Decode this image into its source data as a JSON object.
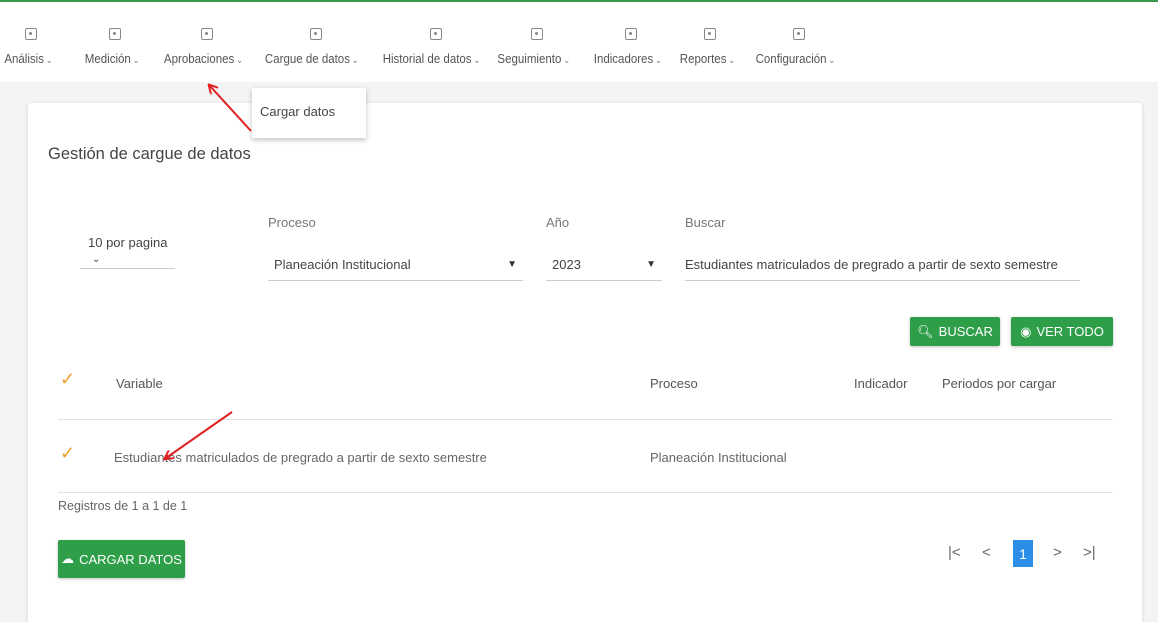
{
  "nav": {
    "items": [
      {
        "label": "Análisis"
      },
      {
        "label": "Medición"
      },
      {
        "label": "Aprobaciones"
      },
      {
        "label": "Cargue de datos"
      },
      {
        "label": "Historial de datos"
      },
      {
        "label": "Seguimiento"
      },
      {
        "label": "Indicadores"
      },
      {
        "label": "Reportes"
      },
      {
        "label": "Configuración"
      }
    ],
    "chevron": "⌄"
  },
  "dropdown": {
    "item": "Cargar datos"
  },
  "page": {
    "title": "Gestión de cargue de datos"
  },
  "filters": {
    "per_page": "10 por pagina",
    "proceso_label": "Proceso",
    "proceso_value": "Planeación Institucional",
    "anio_label": "Año",
    "anio_value": "2023",
    "buscar_label": "Buscar",
    "buscar_value": "Estudiantes matriculados de pregrado a partir de sexto semestre"
  },
  "buttons": {
    "buscar": "BUSCAR",
    "ver_todo": "VER TODO",
    "cargar_datos": "CARGAR DATOS"
  },
  "table": {
    "headers": [
      "Variable",
      "Proceso",
      "Indicador",
      "Periodos por cargar"
    ],
    "rows": [
      {
        "variable": "Estudiantes matriculados de pregrado a partir de sexto semestre",
        "proceso": "Planeación Institucional",
        "indicador": "",
        "periodos": ""
      }
    ]
  },
  "footer": {
    "registros": "Registros de 1 a 1 de 1"
  },
  "pagination": {
    "first": "|<",
    "prev": "<",
    "current": "1",
    "next": ">",
    "last": ">|"
  },
  "colors": {
    "primary_green": "#2e9e48",
    "accent_orange": "#f0a030",
    "active_page_blue": "#2b8fe8",
    "annotation_red": "#e02020"
  }
}
